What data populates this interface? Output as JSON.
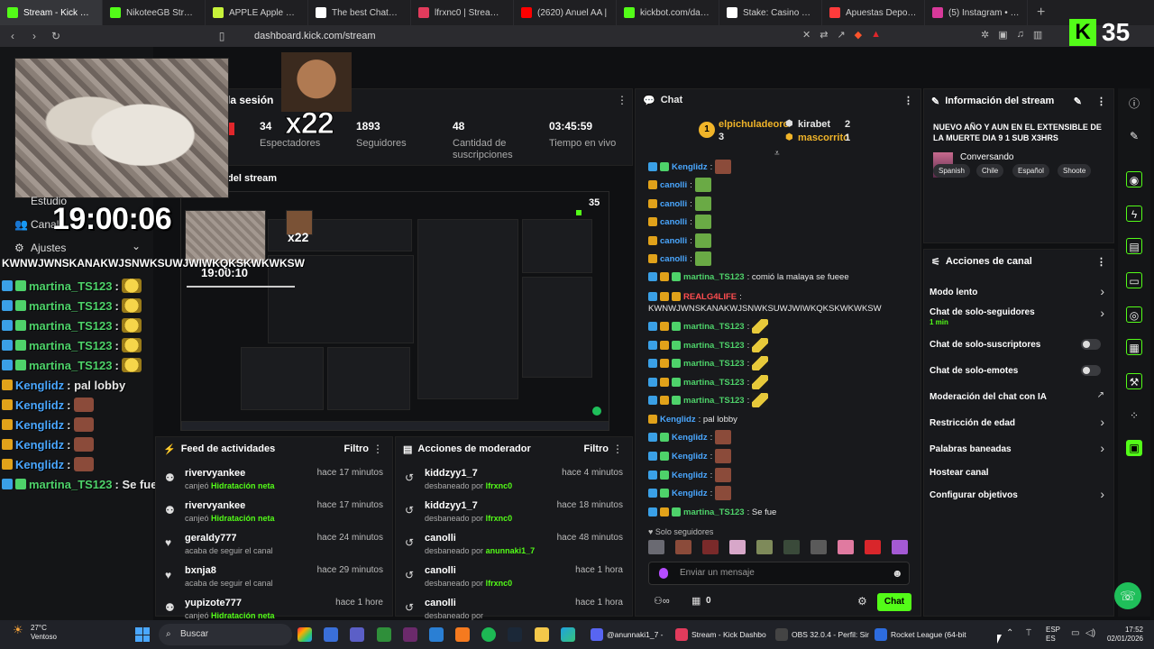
{
  "browser": {
    "tabs": [
      {
        "label": "Stream - Kick Dashb",
        "color": "#53fc18"
      },
      {
        "label": "NikoteeGB Stream - W",
        "color": "#53fc18"
      },
      {
        "label": "APPLE Apple Magsafe",
        "color": "#c7f23a"
      },
      {
        "label": "The best ChatBot and",
        "color": "#ffffff"
      },
      {
        "label": "lfrxnc0 | Streamloots |",
        "color": "#e23b5c"
      },
      {
        "label": "(2620) Anuel AA |",
        "color": "#ff0000"
      },
      {
        "label": "kickbot.com/dashboar",
        "color": "#53fc18"
      },
      {
        "label": "Stake: Casino en línea",
        "color": "#ffffff"
      },
      {
        "label": "Apuestas Deportivas",
        "color": "#ff3b3b"
      },
      {
        "label": "(5) Instagram • Mensa",
        "color": "#d8399a"
      }
    ],
    "new_tab": "+",
    "url": "dashboard.kick.com/stream"
  },
  "kick_badge": {
    "letter": "K",
    "count": "35"
  },
  "stats": {
    "title": "la sesión",
    "items": [
      {
        "value": "34",
        "label": "Espectadores"
      },
      {
        "value": "1893",
        "label": "Seguidores"
      },
      {
        "value": "48",
        "label": "Cantidad de suscripciones"
      },
      {
        "value": "03:45:59",
        "label": "Tiempo en vivo"
      }
    ]
  },
  "overlay": {
    "multiplier": "x22",
    "clock": "19:00:06",
    "stream_preview_title": "del stream",
    "nav": {
      "estudio": "Estudio",
      "canal": "Canal",
      "ajustes": "Ajustes"
    },
    "spam": "KWNWJWNSKANAKWJSNWKSUWJWIWKQKSKWKWKSW",
    "chat": [
      {
        "name": "martina_TS123",
        "color": "#4ed26a",
        "text": ":",
        "emote": "em-yellow"
      },
      {
        "name": "martina_TS123",
        "color": "#4ed26a",
        "text": ":",
        "emote": "em-yellow"
      },
      {
        "name": "martina_TS123",
        "color": "#4ed26a",
        "text": ":",
        "emote": "em-yellow"
      },
      {
        "name": "martina_TS123",
        "color": "#4ed26a",
        "text": ":",
        "emote": "em-yellow"
      },
      {
        "name": "martina_TS123",
        "color": "#4ed26a",
        "text": ":",
        "emote": "em-yellow"
      },
      {
        "name": "Kenglidz",
        "color": "#4aa7ff",
        "text": ": pal lobby",
        "emote": ""
      },
      {
        "name": "Kenglidz",
        "color": "#4aa7ff",
        "text": ":",
        "emote": "em-brown"
      },
      {
        "name": "Kenglidz",
        "color": "#4aa7ff",
        "text": ":",
        "emote": "em-brown"
      },
      {
        "name": "Kenglidz",
        "color": "#4aa7ff",
        "text": ":",
        "emote": "em-brown"
      },
      {
        "name": "Kenglidz",
        "color": "#4aa7ff",
        "text": ":",
        "emote": "em-brown"
      },
      {
        "name": "martina_TS123",
        "color": "#4ed26a",
        "text": ": Se fue",
        "emote": ""
      }
    ]
  },
  "preview": {
    "clock": "19:00:10",
    "kick_count": "35",
    "multiplier": "x22"
  },
  "activity_feed": {
    "title": "Feed de actividades",
    "filter": "Filtro",
    "items": [
      {
        "icon": "redeem",
        "name": "rivervyankee",
        "action": "canjeó",
        "highlight": "Hidratación neta",
        "time": "hace 17 minutos"
      },
      {
        "icon": "redeem",
        "name": "rivervyankee",
        "action": "canjeó",
        "highlight": "Hidratación neta",
        "time": "hace 17 minutos"
      },
      {
        "icon": "heart",
        "name": "geraldy777",
        "action": "acaba de seguir el canal",
        "highlight": "",
        "time": "hace 24 minutos"
      },
      {
        "icon": "heart",
        "name": "bxnja8",
        "action": "acaba de seguir el canal",
        "highlight": "",
        "time": "hace 29 minutos"
      },
      {
        "icon": "redeem",
        "name": "yupizote777",
        "action": "canjeó",
        "highlight": "Hidratación neta",
        "time": "hace 1 hore"
      }
    ]
  },
  "mod_actions": {
    "title": "Acciones de moderador",
    "filter": "Filtro",
    "items": [
      {
        "name": "kiddzyy1_7",
        "action": "desbaneado por",
        "by": "lfrxnc0",
        "time": "hace 4 minutos"
      },
      {
        "name": "kiddzyy1_7",
        "action": "desbaneado por",
        "by": "lfrxnc0",
        "time": "hace 18 minutos"
      },
      {
        "name": "canolli",
        "action": "desbaneado por",
        "by": "anunnaki1_7",
        "time": "hace 48 minutos"
      },
      {
        "name": "canolli",
        "action": "desbaneado por",
        "by": "lfrxnc0",
        "time": "hace 1 hora"
      },
      {
        "name": "canolli",
        "action": "desbaneado por",
        "by": "",
        "time": "hace 1 hora"
      }
    ]
  },
  "chat": {
    "title": "Chat",
    "top_donors": [
      {
        "name": "elpichuladeoro",
        "count": "3",
        "color": "#f0b429"
      },
      {
        "name": "kirabet",
        "count": "2",
        "color": "#e8e8e8"
      },
      {
        "name": "mascorrito",
        "count": "1",
        "color": "#f0b429"
      }
    ],
    "messages": [
      {
        "name": "Kenglidz",
        "color": "#4aa7ff",
        "text": ":",
        "emote": "em-brown",
        "badges": [
          "b-blue",
          "b-green"
        ]
      },
      {
        "name": "canolli",
        "color": "#4aa7ff",
        "text": ":",
        "emote": "em-frog",
        "badges": [
          "b-gold"
        ]
      },
      {
        "name": "canolli",
        "color": "#4aa7ff",
        "text": ":",
        "emote": "em-frog",
        "badges": [
          "b-gold"
        ]
      },
      {
        "name": "canolli",
        "color": "#4aa7ff",
        "text": ":",
        "emote": "em-frog",
        "badges": [
          "b-gold"
        ]
      },
      {
        "name": "canolli",
        "color": "#4aa7ff",
        "text": ":",
        "emote": "em-frog",
        "badges": [
          "b-gold"
        ]
      },
      {
        "name": "canolli",
        "color": "#4aa7ff",
        "text": ":",
        "emote": "em-frog",
        "badges": [
          "b-gold"
        ]
      },
      {
        "name": "martina_TS123",
        "color": "#4ed26a",
        "text": ": comió la malaya se fueee",
        "emote": "",
        "badges": [
          "b-blue",
          "b-gold",
          "b-green"
        ]
      },
      {
        "name": "REALG4LIFE",
        "color": "#ff4d4f",
        "text": ":",
        "emote": "",
        "badges": [
          "b-blue",
          "b-gold",
          "b-gold"
        ]
      },
      {
        "name": "",
        "color": "#e8e8e8",
        "text": "KWNWJWNSKANAKWJSNWKSUWJWIWKQKSKWKWKSW",
        "emote": "",
        "badges": []
      },
      {
        "name": "martina_TS123",
        "color": "#4ed26a",
        "text": ":",
        "emote": "em-banana",
        "badges": [
          "b-blue",
          "b-gold",
          "b-green"
        ]
      },
      {
        "name": "martina_TS123",
        "color": "#4ed26a",
        "text": ":",
        "emote": "em-banana",
        "badges": [
          "b-blue",
          "b-gold",
          "b-green"
        ]
      },
      {
        "name": "martina_TS123",
        "color": "#4ed26a",
        "text": ":",
        "emote": "em-banana",
        "badges": [
          "b-blue",
          "b-gold",
          "b-green"
        ]
      },
      {
        "name": "martina_TS123",
        "color": "#4ed26a",
        "text": ":",
        "emote": "em-banana",
        "badges": [
          "b-blue",
          "b-gold",
          "b-green"
        ]
      },
      {
        "name": "martina_TS123",
        "color": "#4ed26a",
        "text": ":",
        "emote": "em-banana",
        "badges": [
          "b-blue",
          "b-gold",
          "b-green"
        ]
      },
      {
        "name": "Kenglidz",
        "color": "#4aa7ff",
        "text": ": pal lobby",
        "emote": "",
        "badges": [
          "b-gold"
        ]
      },
      {
        "name": "Kenglidz",
        "color": "#4aa7ff",
        "text": ":",
        "emote": "em-brown",
        "badges": [
          "b-blue",
          "b-green"
        ]
      },
      {
        "name": "Kenglidz",
        "color": "#4aa7ff",
        "text": ":",
        "emote": "em-brown",
        "badges": [
          "b-blue",
          "b-green"
        ]
      },
      {
        "name": "Kenglidz",
        "color": "#4aa7ff",
        "text": ":",
        "emote": "em-brown",
        "badges": [
          "b-blue",
          "b-green"
        ]
      },
      {
        "name": "Kenglidz",
        "color": "#4aa7ff",
        "text": ":",
        "emote": "em-brown",
        "badges": [
          "b-blue",
          "b-green"
        ]
      },
      {
        "name": "martina_TS123",
        "color": "#4ed26a",
        "text": ": Se fue",
        "emote": "",
        "badges": [
          "b-blue",
          "b-gold",
          "b-green"
        ]
      }
    ],
    "mode": "Solo seguidores",
    "input_placeholder": "Enviar un mensaje",
    "points": "0",
    "send_label": "Chat"
  },
  "stream_info": {
    "title": "Información del stream",
    "stream_title": "NUEVO AÑO Y AUN EN EL EXTENSIBLE DE LA MUERTE DIA 9 1 SUB X3HRS",
    "category": "Conversando",
    "tags": [
      "Spanish",
      "Chile",
      "Español",
      "Shoote"
    ]
  },
  "channel_actions": {
    "title": "Acciones de canal",
    "items": [
      {
        "label": "Modo lento",
        "sub": "",
        "control": "chevron"
      },
      {
        "label": "Chat de solo-seguidores",
        "sub": "1 min",
        "control": "chevron"
      },
      {
        "label": "Chat de solo-suscriptores",
        "sub": "",
        "control": "toggle"
      },
      {
        "label": "Chat de solo-emotes",
        "sub": "",
        "control": "toggle"
      },
      {
        "label": "Moderación del chat con IA",
        "sub": "",
        "control": "external"
      },
      {
        "label": "Restricción de edad",
        "sub": "",
        "control": "chevron"
      },
      {
        "label": "Palabras baneadas",
        "sub": "",
        "control": "chevron"
      },
      {
        "label": "Hostear canal",
        "sub": "",
        "control": ""
      },
      {
        "label": "Configurar objetivos",
        "sub": "",
        "control": "chevron"
      }
    ]
  },
  "taskbar": {
    "weather_temp": "27°C",
    "weather_desc": "Ventoso",
    "search": "Buscar",
    "tasks": [
      {
        "label": "@anunnaki1_7 -",
        "color": "#5865f2"
      },
      {
        "label": "Stream - Kick Dashbo",
        "color": "#e23b5c"
      },
      {
        "label": "OBS 32.0.4 - Perfil: Sir",
        "color": "#444444"
      },
      {
        "label": "Rocket League (64-bit",
        "color": "#2d6cdf"
      }
    ],
    "lang": "ESP",
    "lang2": "ES",
    "time": "17:52",
    "date": "02/01/2026"
  }
}
